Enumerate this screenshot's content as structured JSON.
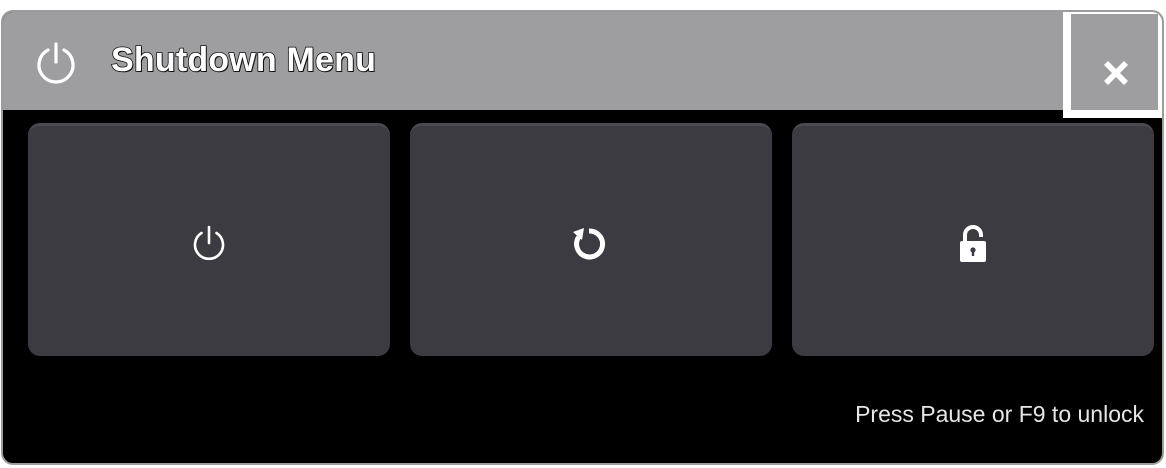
{
  "dialog": {
    "title": "Shutdown Menu",
    "title_icon": "power-icon",
    "close_icon": "close-x-icon"
  },
  "actions": [
    {
      "name": "shutdown",
      "icon": "power-icon"
    },
    {
      "name": "restart",
      "icon": "restart-icon"
    },
    {
      "name": "lock",
      "icon": "lock-icon"
    }
  ],
  "footer": {
    "hint": "Press Pause or F9 to unlock"
  },
  "colors": {
    "titlebar": "#9e9ea0",
    "button_bg": "#3b3b41",
    "background": "#000000",
    "icon": "#ffffff"
  }
}
